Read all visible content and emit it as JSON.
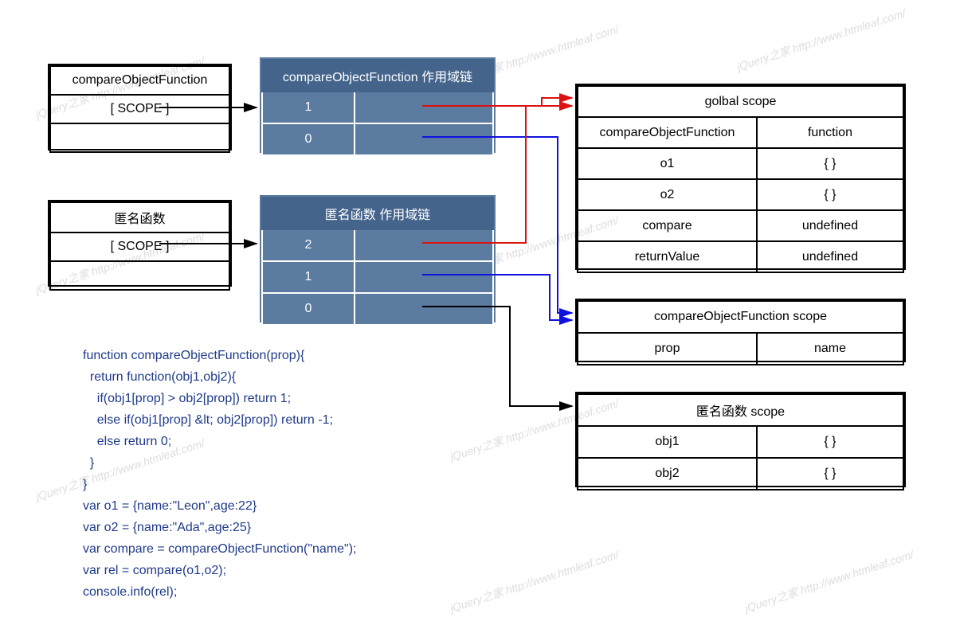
{
  "watermark": "jQuery之家  http://www.htmleaf.com/",
  "leftBox1": {
    "title": "compareObjectFunction",
    "scope": "[ SCOPE ]"
  },
  "leftBox2": {
    "title": "匿名函数",
    "scope": "[ SCOPE ]"
  },
  "chain1": {
    "header": "compareObjectFunction 作用域链",
    "rows": [
      "1",
      "0"
    ]
  },
  "chain2": {
    "header": "匿名函数 作用域链",
    "rows": [
      "2",
      "1",
      "0"
    ]
  },
  "global": {
    "header": "golbal scope",
    "rows": [
      [
        "compareObjectFunction",
        "function"
      ],
      [
        "o1",
        "{ }"
      ],
      [
        "o2",
        "{ }"
      ],
      [
        "compare",
        "undefined"
      ],
      [
        "returnValue",
        "undefined"
      ]
    ]
  },
  "cofScope": {
    "header": "compareObjectFunction scope",
    "rows": [
      [
        "prop",
        "name"
      ]
    ]
  },
  "anonScope": {
    "header": "匿名函数 scope",
    "rows": [
      [
        "obj1",
        "{ }"
      ],
      [
        "obj2",
        "{ }"
      ]
    ]
  },
  "code": {
    "l1": "function compareObjectFunction(prop){",
    "l2": "  return function(obj1,obj2){",
    "l3": "    if(obj1[prop] > obj2[prop]) return 1;",
    "l4": "    else if(obj1[prop] &lt; obj2[prop]) return -1;",
    "l5": "    else return 0;",
    "l6": "  }",
    "l7": "}",
    "l8": "var o1 = {name:\"Leon\",age:22}",
    "l9": "var o2 = {name:\"Ada\",age:25}",
    "l10": "var compare = compareObjectFunction(\"name\");",
    "l11": "var rel = compare(o1,o2);",
    "l12": "console.info(rel);"
  }
}
